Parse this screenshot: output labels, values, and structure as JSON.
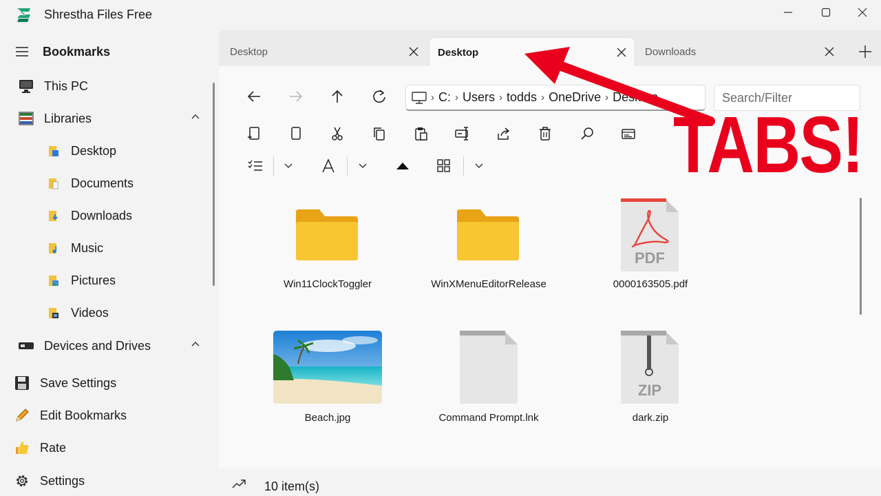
{
  "app": {
    "title": "Shrestha Files Free"
  },
  "sidebar": {
    "menu_label": "Bookmarks",
    "this_pc": "This PC",
    "libraries": "Libraries",
    "library_items": [
      "Desktop",
      "Documents",
      "Downloads",
      "Music",
      "Pictures",
      "Videos"
    ],
    "devices": "Devices and Drives",
    "save_settings": "Save Settings",
    "edit_bookmarks": "Edit Bookmarks",
    "rate": "Rate",
    "settings": "Settings"
  },
  "tabs": [
    {
      "label": "Desktop",
      "active": false
    },
    {
      "label": "Desktop",
      "active": true
    },
    {
      "label": "Downloads",
      "active": false
    }
  ],
  "address": {
    "segments": [
      "C:",
      "Users",
      "todds",
      "OneDrive",
      "Desktop"
    ]
  },
  "search": {
    "placeholder": "Search/Filter"
  },
  "files": [
    {
      "name": "Win11ClockToggler",
      "type": "folder"
    },
    {
      "name": "WinXMenuEditorRelease",
      "type": "folder"
    },
    {
      "name": "0000163505.pdf",
      "type": "pdf",
      "badge": "PDF"
    },
    {
      "name": "Beach.jpg",
      "type": "image"
    },
    {
      "name": "Command Prompt.lnk",
      "type": "file"
    },
    {
      "name": "dark.zip",
      "type": "zip",
      "badge": "ZIP"
    }
  ],
  "status": {
    "count": "10 item(s)"
  },
  "annotation": {
    "text": "TABS!"
  },
  "colors": {
    "accent": "#1fa37a",
    "annotation": "#e8001c",
    "folder": "#f7c631"
  }
}
